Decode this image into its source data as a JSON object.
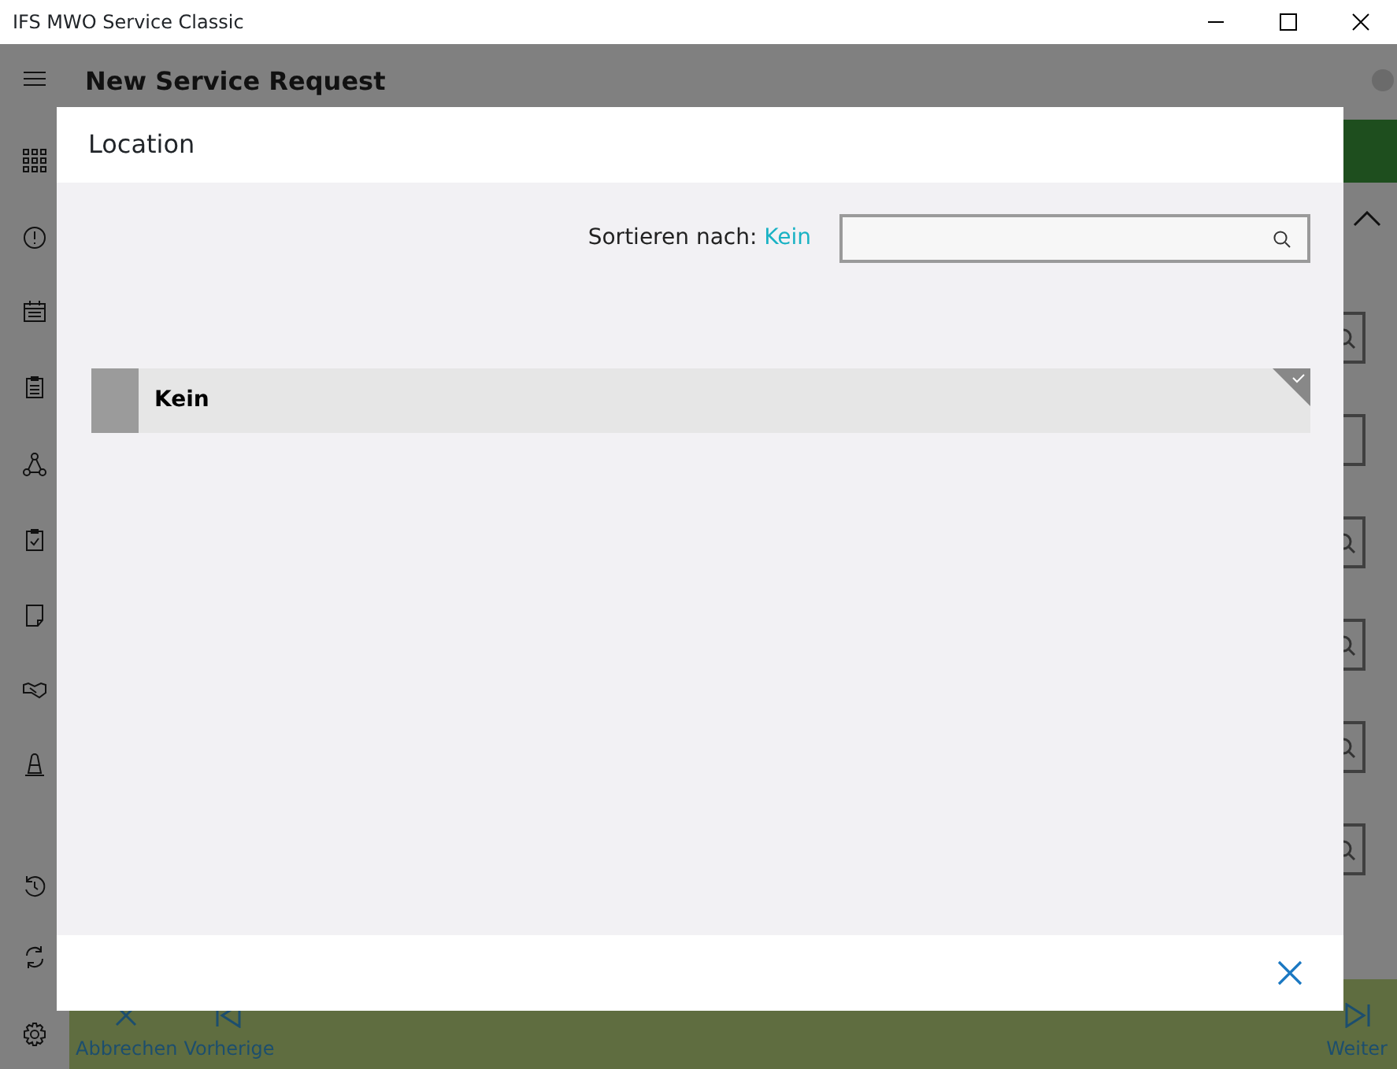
{
  "window": {
    "title": "IFS MWO Service Classic"
  },
  "page": {
    "title": "New Service Request"
  },
  "behind_fields": [
    {
      "search": true
    },
    {
      "search": false
    },
    {
      "search": true
    },
    {
      "search": true
    },
    {
      "search": true
    },
    {
      "search": true
    }
  ],
  "bottom_bar": {
    "buttons": [
      {
        "label": "Abbrechen",
        "kind": "cancel"
      },
      {
        "label": "Vorherige",
        "kind": "previous"
      },
      {
        "label": "Weiter",
        "kind": "next"
      }
    ]
  },
  "dialog": {
    "title": "Location",
    "sort_label": "Sortieren nach:",
    "sort_value": "Kein",
    "items": [
      {
        "label": "Kein",
        "selected": true
      }
    ]
  }
}
